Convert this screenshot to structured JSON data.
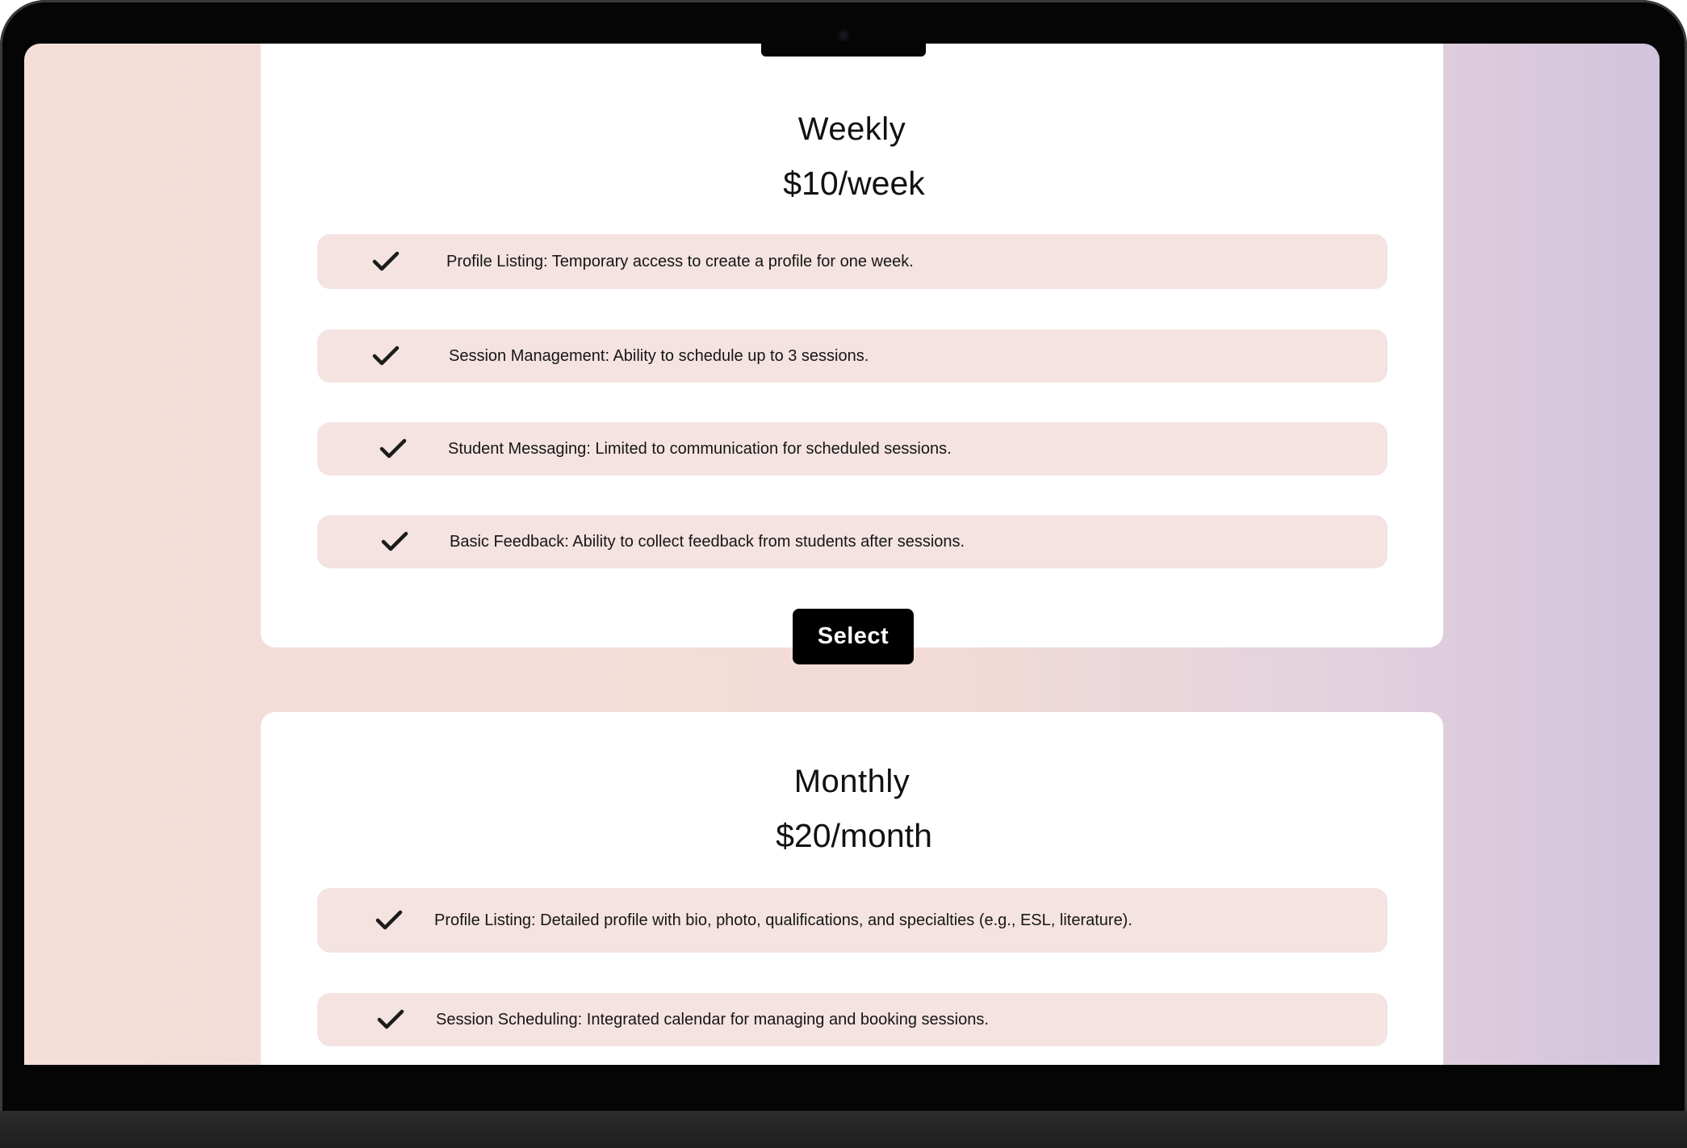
{
  "plans": [
    {
      "name": "Weekly",
      "price": "$10/week",
      "features": [
        {
          "icon": "check-icon",
          "text": "Profile Listing: Temporary access to create a profile for one week."
        },
        {
          "icon": "check-icon",
          "text": "Session Management: Ability to schedule up to 3 sessions."
        },
        {
          "icon": "check-icon",
          "text": "Student Messaging: Limited to communication for scheduled sessions."
        },
        {
          "icon": "check-icon",
          "text": "Basic Feedback: Ability to collect feedback from students after sessions."
        }
      ],
      "button_label": "Select"
    },
    {
      "name": "Monthly",
      "price": "$20/month",
      "features": [
        {
          "icon": "check-icon",
          "text": "Profile Listing: Detailed profile with bio, photo, qualifications, and specialties (e.g., ESL, literature)."
        },
        {
          "icon": "check-icon",
          "text": "Session Scheduling: Integrated calendar for managing and booking sessions."
        }
      ]
    }
  ],
  "colors": {
    "background_left": "#f5ddd8",
    "background_right": "#d3c3dc",
    "card": "#ffffff",
    "feature_row": "#f4e3e1",
    "button": "#000000",
    "button_text": "#ffffff",
    "text": "#111111"
  }
}
